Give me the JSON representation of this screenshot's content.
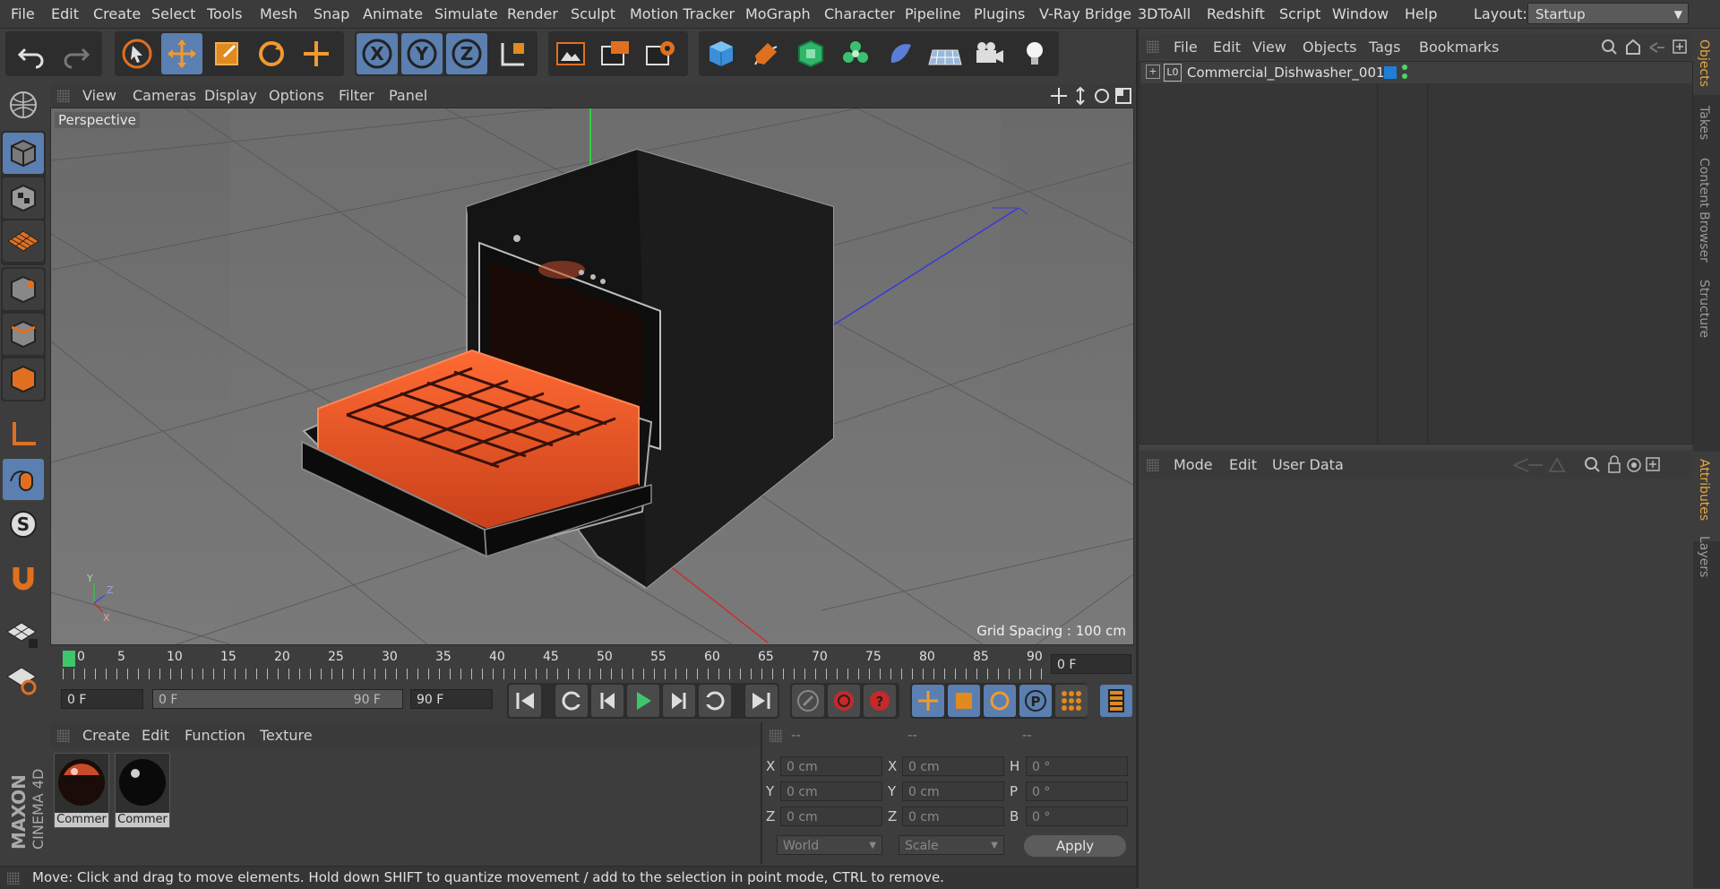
{
  "menu": {
    "items": [
      "File",
      "Edit",
      "Create",
      "Select",
      "Tools",
      "Mesh",
      "Snap",
      "Animate",
      "Simulate",
      "Render",
      "Sculpt",
      "Motion Tracker",
      "MoGraph",
      "Character",
      "Pipeline",
      "Plugins",
      "V-Ray Bridge",
      "3DToAll",
      "Redshift",
      "Script",
      "Window",
      "Help"
    ],
    "layout_label": "Layout:",
    "layout_value": "Startup"
  },
  "viewport": {
    "menu": [
      "View",
      "Cameras",
      "Display",
      "Options",
      "Filter",
      "Panel"
    ],
    "camera_label": "Perspective",
    "grid_spacing": "Grid Spacing : 100 cm",
    "axis_labels": {
      "y": "Y",
      "z": "Z",
      "x": "X"
    }
  },
  "timeline": {
    "ticks": [
      "0",
      "5",
      "10",
      "15",
      "20",
      "25",
      "30",
      "35",
      "40",
      "45",
      "50",
      "55",
      "60",
      "65",
      "70",
      "75",
      "80",
      "85",
      "90"
    ],
    "current_frame": "0 F"
  },
  "transport": {
    "start_field": "0 F",
    "range_start": "0 F",
    "range_end": "90 F",
    "end_field": "90 F"
  },
  "material_manager": {
    "menu": [
      "Create",
      "Edit",
      "Function",
      "Texture"
    ],
    "materials": [
      {
        "name": "Commer"
      },
      {
        "name": "Commer"
      }
    ]
  },
  "coordinates": {
    "headers": [
      "--",
      "--",
      "--"
    ],
    "rows": [
      {
        "l1": "X",
        "v1": "0 cm",
        "l2": "X",
        "v2": "0 cm",
        "l3": "H",
        "v3": "0 °"
      },
      {
        "l1": "Y",
        "v1": "0 cm",
        "l2": "Y",
        "v2": "0 cm",
        "l3": "P",
        "v3": "0 °"
      },
      {
        "l1": "Z",
        "v1": "0 cm",
        "l2": "Z",
        "v2": "0 cm",
        "l3": "B",
        "v3": "0 °"
      }
    ],
    "mode_select": "World",
    "scale_select": "Scale",
    "apply": "Apply"
  },
  "status": "Move: Click and drag to move elements. Hold down SHIFT to quantize movement / add to the selection in point mode, CTRL to remove.",
  "object_manager": {
    "menu": [
      "File",
      "Edit",
      "View",
      "Objects",
      "Tags",
      "Bookmarks"
    ],
    "objects": [
      {
        "name": "Commercial_Dishwasher_001",
        "layer_letter": "L0"
      }
    ]
  },
  "attributes": {
    "menu": [
      "Mode",
      "Edit",
      "User Data"
    ]
  },
  "right_tabs": [
    "Objects",
    "Takes",
    "Content Browser",
    "Structure",
    "Attributes",
    "Layers"
  ],
  "brand": {
    "line1": "MAXON",
    "line2": "CINEMA 4D"
  },
  "colors": {
    "accent_orange": "#e8a640",
    "selected_blue": "#5a7fb0",
    "playhead_green": "#3ec76a"
  }
}
